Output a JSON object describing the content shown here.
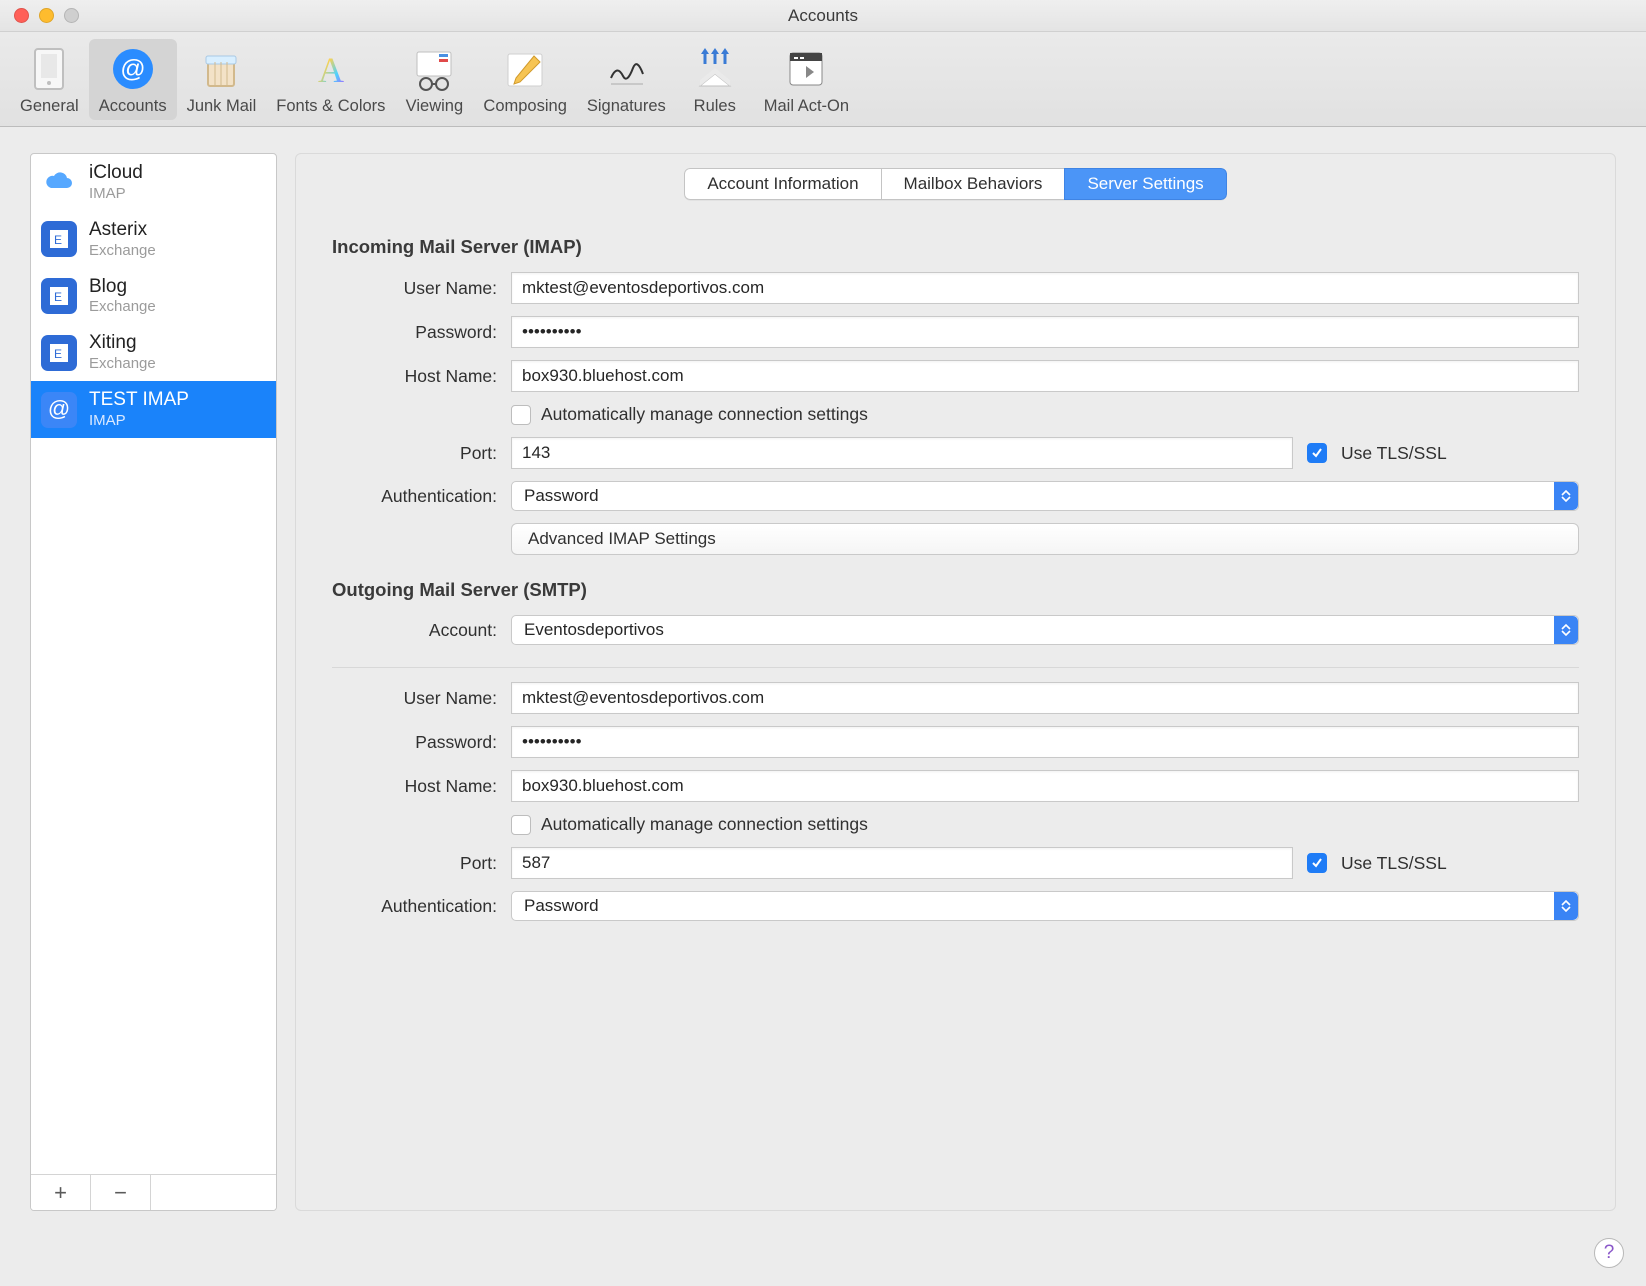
{
  "window": {
    "title": "Accounts"
  },
  "toolbar": {
    "items": [
      {
        "label": "General"
      },
      {
        "label": "Accounts"
      },
      {
        "label": "Junk Mail"
      },
      {
        "label": "Fonts & Colors"
      },
      {
        "label": "Viewing"
      },
      {
        "label": "Composing"
      },
      {
        "label": "Signatures"
      },
      {
        "label": "Rules"
      },
      {
        "label": "Mail Act-On"
      }
    ],
    "active_index": 1
  },
  "sidebar": {
    "accounts": [
      {
        "name": "iCloud",
        "protocol": "IMAP",
        "icon": "cloud"
      },
      {
        "name": "Asterix",
        "protocol": "Exchange",
        "icon": "exchange"
      },
      {
        "name": "Blog",
        "protocol": "Exchange",
        "icon": "exchange"
      },
      {
        "name": "Xiting",
        "protocol": "Exchange",
        "icon": "exchange"
      },
      {
        "name": "TEST IMAP",
        "protocol": "IMAP",
        "icon": "at"
      }
    ],
    "selected_index": 4,
    "footer": {
      "add": "+",
      "remove": "−"
    }
  },
  "tabs": {
    "items": [
      "Account Information",
      "Mailbox Behaviors",
      "Server Settings"
    ],
    "active_index": 2
  },
  "form": {
    "incoming": {
      "heading": "Incoming Mail Server (IMAP)",
      "labels": {
        "user_name": "User Name:",
        "password": "Password:",
        "host_name": "Host Name:",
        "auto": "Automatically manage connection settings",
        "port": "Port:",
        "tls": "Use TLS/SSL",
        "auth": "Authentication:",
        "advanced_btn": "Advanced IMAP Settings"
      },
      "values": {
        "user_name": "mktest@eventosdeportivos.com",
        "password": "••••••••••",
        "host_name": "box930.bluehost.com",
        "auto_checked": false,
        "port": "143",
        "tls_checked": true,
        "auth": "Password"
      }
    },
    "outgoing": {
      "heading": "Outgoing Mail Server (SMTP)",
      "labels": {
        "account": "Account:",
        "user_name": "User Name:",
        "password": "Password:",
        "host_name": "Host Name:",
        "auto": "Automatically manage connection settings",
        "port": "Port:",
        "tls": "Use TLS/SSL",
        "auth": "Authentication:"
      },
      "values": {
        "account": "Eventosdeportivos",
        "user_name": "mktest@eventosdeportivos.com",
        "password": "••••••••••",
        "host_name": "box930.bluehost.com",
        "auto_checked": false,
        "port": "587",
        "tls_checked": true,
        "auth": "Password"
      }
    }
  },
  "help": {
    "glyph": "?"
  }
}
